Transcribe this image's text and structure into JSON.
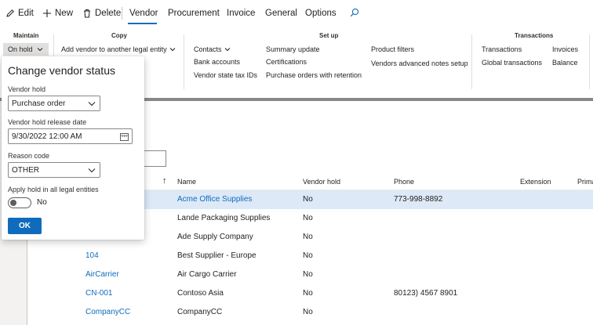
{
  "commandbar": {
    "edit_label": "Edit",
    "new_label": "New",
    "delete_label": "Delete",
    "tabs": [
      "Vendor",
      "Procurement",
      "Invoice",
      "General",
      "Options"
    ],
    "active_tab": "Vendor",
    "search_icon": "search-icon",
    "accent_color": "#0f6cbd"
  },
  "ribbon": {
    "maintain": {
      "title": "Maintain",
      "on_hold_label": "On hold"
    },
    "copy": {
      "title": "Copy",
      "add_vendor_label": "Add vendor to another legal entity"
    },
    "setup": {
      "title": "Set up",
      "col1": [
        "Contacts",
        "Bank accounts",
        "Vendor state tax IDs"
      ],
      "col2": [
        "Summary update",
        "Certifications",
        "Purchase orders with retention"
      ],
      "col3": [
        "Product filters",
        "Vendors advanced notes setup"
      ]
    },
    "transactions": {
      "title": "Transactions",
      "col1": [
        "Transactions",
        "Global transactions"
      ],
      "col2": [
        "Invoices",
        "Balance"
      ]
    }
  },
  "dialog": {
    "title": "Change vendor status",
    "vendor_hold_label": "Vendor hold",
    "vendor_hold_value": "Purchase order",
    "release_date_label": "Vendor hold release date",
    "release_date_value": "9/30/2022 12:00 AM",
    "reason_code_label": "Reason code",
    "reason_code_value": "OTHER",
    "apply_all_label": "Apply hold in all legal entities",
    "apply_all_toggle": "No",
    "ok_label": "OK"
  },
  "grid": {
    "headers": {
      "sort_arrow": "↑",
      "name": "Name",
      "vendor_hold": "Vendor hold",
      "phone": "Phone",
      "extension": "Extension",
      "primary": "Prima"
    },
    "rows": [
      {
        "account": "",
        "name": "Acme Office Supplies",
        "hold": "No",
        "phone": "773-998-8892",
        "selected": true
      },
      {
        "account": "",
        "name": "Lande Packaging Supplies",
        "hold": "No",
        "phone": ""
      },
      {
        "account": "",
        "name": "Ade Supply Company",
        "hold": "No",
        "phone": ""
      },
      {
        "account": "104",
        "name": "Best Supplier - Europe",
        "hold": "No",
        "phone": ""
      },
      {
        "account": "AirCarrier",
        "name": "Air Cargo Carrier",
        "hold": "No",
        "phone": ""
      },
      {
        "account": "CN-001",
        "name": "Contoso Asia",
        "hold": "No",
        "phone": "80123) 4567 8901"
      },
      {
        "account": "CompanyCC",
        "name": "CompanyCC",
        "hold": "No",
        "phone": ""
      }
    ]
  }
}
